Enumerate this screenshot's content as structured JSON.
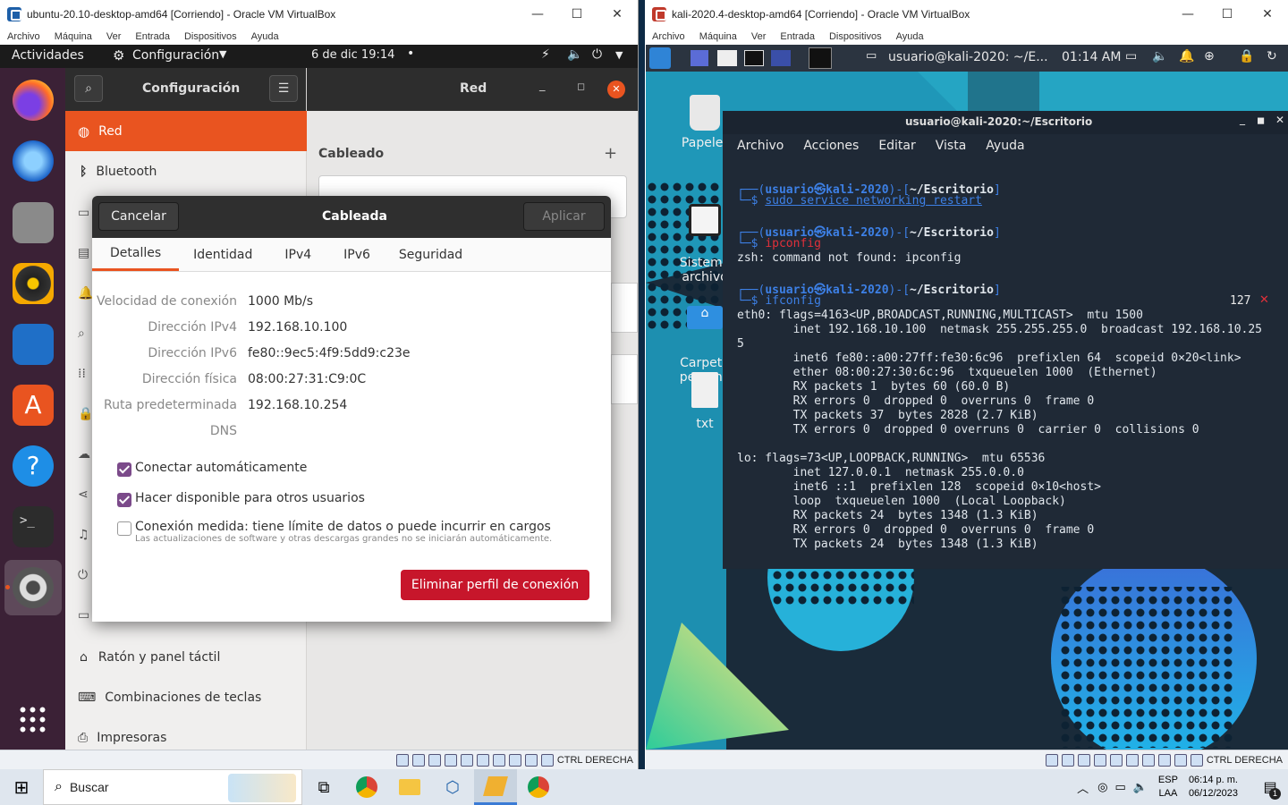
{
  "ubuntu_vm": {
    "window_title": "ubuntu-20.10-desktop-amd64 [Corriendo] - Oracle VM VirtualBox",
    "menu": [
      "Archivo",
      "Máquina",
      "Ver",
      "Entrada",
      "Dispositivos",
      "Ayuda"
    ],
    "topbar": {
      "activities": "Actividades",
      "app_menu": "Configuración",
      "clock": "6 de dic  19:14"
    },
    "settings": {
      "sidebar_title": "Configuración",
      "panel_title": "Red",
      "items": [
        "Red",
        "Bluetooth",
        "Ratón y panel táctil",
        "Combinaciones de teclas",
        "Impresoras"
      ],
      "section": "Cableado"
    },
    "dialog": {
      "cancel": "Cancelar",
      "title": "Cableada",
      "apply": "Aplicar",
      "tabs": [
        "Detalles",
        "Identidad",
        "IPv4",
        "IPv6",
        "Seguridad"
      ],
      "details": [
        {
          "k": "Velocidad de conexión",
          "v": "1000 Mb/s"
        },
        {
          "k": "Dirección IPv4",
          "v": "192.168.10.100"
        },
        {
          "k": "Dirección IPv6",
          "v": "fe80::9ec5:4f9:5dd9:c23e"
        },
        {
          "k": "Dirección física",
          "v": "08:00:27:31:C9:0C"
        },
        {
          "k": "Ruta predeterminada",
          "v": "192.168.10.254"
        },
        {
          "k": "DNS",
          "v": ""
        }
      ],
      "auto_connect": "Conectar automáticamente",
      "share_users": "Hacer disponible para otros usuarios",
      "metered": "Conexión medida: tiene límite de datos o puede incurrir en cargos",
      "metered_hint": "Las actualizaciones de software y otras descargas grandes no se iniciarán automáticamente.",
      "delete": "Eliminar perfil de conexión"
    },
    "status_key": "CTRL DERECHA"
  },
  "kali_vm": {
    "window_title": "kali-2020.4-desktop-amd64 [Corriendo] - Oracle VM VirtualBox",
    "menu": [
      "Archivo",
      "Máquina",
      "Ver",
      "Entrada",
      "Dispositivos",
      "Ayuda"
    ],
    "panel": {
      "task": "usuario@kali-2020: ~/E...",
      "clock": "01:14 AM"
    },
    "desktop_icons": [
      "Papeler",
      "Sistema\narchivo",
      "Carpeta\npersona",
      "txt"
    ],
    "terminal": {
      "title": "usuario@kali-2020:~/Escritorio",
      "menu": [
        "Archivo",
        "Acciones",
        "Editar",
        "Vista",
        "Ayuda"
      ],
      "prompt_user": "usuario㉿kali-2020",
      "prompt_dir": "~/Escritorio",
      "cmd1": "sudo service networking restart",
      "cmd2": "ipconfig",
      "err": "zsh: command not found: ipconfig",
      "cmd3": "ifconfig",
      "exit_code": "127",
      "output": [
        "eth0: flags=4163<UP,BROADCAST,RUNNING,MULTICAST>  mtu 1500",
        "        inet 192.168.10.100  netmask 255.255.255.0  broadcast 192.168.10.25",
        "5",
        "        inet6 fe80::a00:27ff:fe30:6c96  prefixlen 64  scopeid 0×20<link>",
        "        ether 08:00:27:30:6c:96  txqueuelen 1000  (Ethernet)",
        "        RX packets 1  bytes 60 (60.0 B)",
        "        RX errors 0  dropped 0  overruns 0  frame 0",
        "        TX packets 37  bytes 2828 (2.7 KiB)",
        "        TX errors 0  dropped 0 overruns 0  carrier 0  collisions 0",
        "",
        "lo: flags=73<UP,LOOPBACK,RUNNING>  mtu 65536",
        "        inet 127.0.0.1  netmask 255.0.0.0",
        "        inet6 ::1  prefixlen 128  scopeid 0×10<host>",
        "        loop  txqueuelen 1000  (Local Loopback)",
        "        RX packets 24  bytes 1348 (1.3 KiB)",
        "        RX errors 0  dropped 0  overruns 0  frame 0",
        "        TX packets 24  bytes 1348 (1.3 KiB)"
      ]
    },
    "status_key": "CTRL DERECHA"
  },
  "taskbar": {
    "search": "Buscar",
    "lang1": "ESP",
    "lang2": "LAA",
    "time": "06:14 p. m.",
    "date": "06/12/2023",
    "notif": "1"
  }
}
